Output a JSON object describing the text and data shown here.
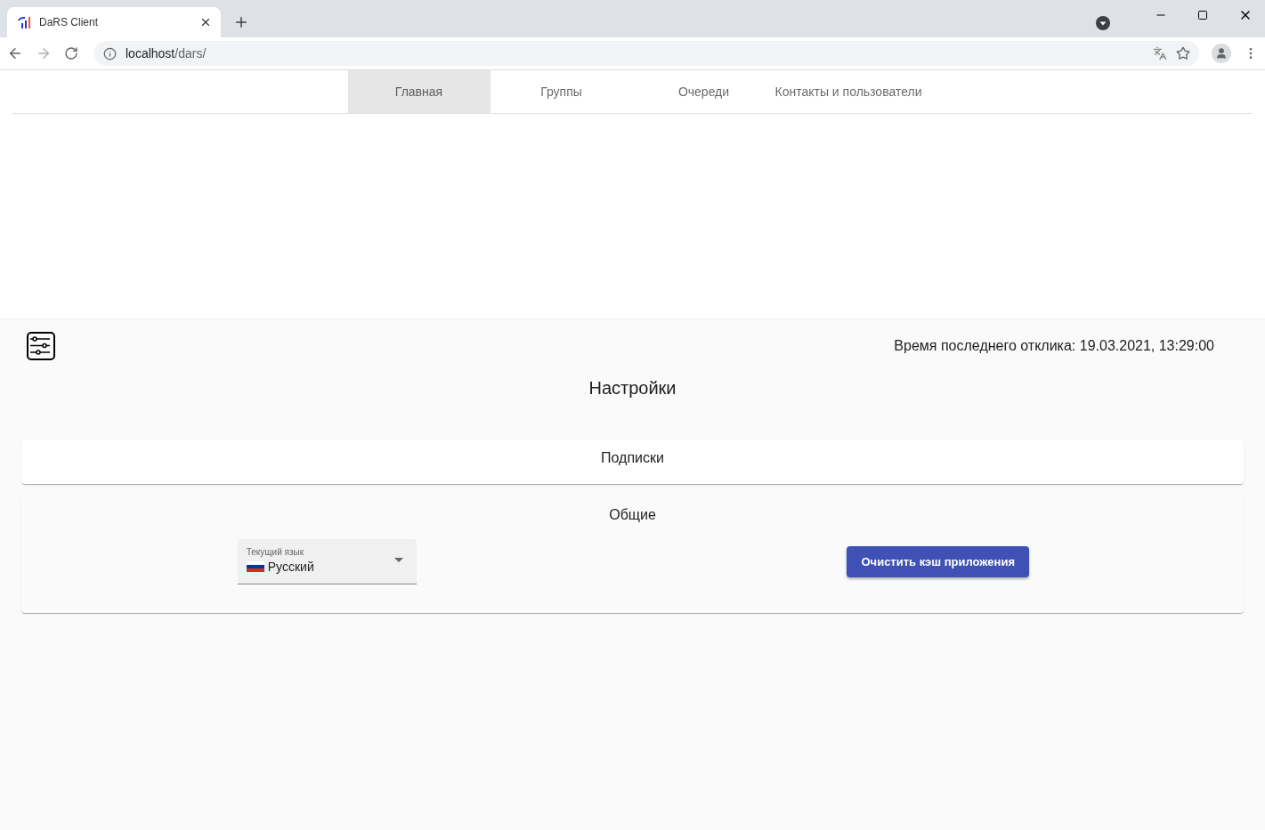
{
  "browser": {
    "tab_title": "DaRS Client",
    "url_host": "localhost",
    "url_path": "/dars/"
  },
  "nav": {
    "tabs": [
      {
        "label": "Главная",
        "selected": true
      },
      {
        "label": "Группы",
        "selected": false
      },
      {
        "label": "Очереди",
        "selected": false
      },
      {
        "label": "Контакты и пользователи",
        "selected": false
      }
    ]
  },
  "last_response": "Время последнего отклика: 19.03.2021, 13:29:00",
  "title": "Настройки",
  "sections": [
    {
      "kind": "header",
      "title": "Подписки"
    },
    {
      "kind": "general",
      "title": "Общие",
      "language": {
        "label": "Текущий язык",
        "value": "Русский"
      },
      "button": "Очистить кэш приложения"
    }
  ]
}
